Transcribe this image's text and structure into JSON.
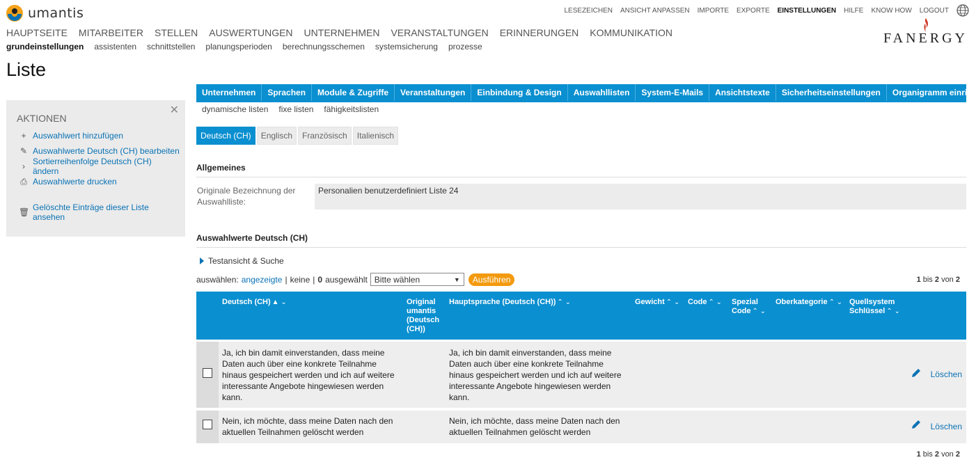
{
  "header": {
    "logo_text": "umantis",
    "brand": "FANERGY",
    "topnav": [
      "LESEZEICHEN",
      "ANSICHT ANPASSEN",
      "IMPORTE",
      "EXPORTE",
      "EINSTELLUNGEN",
      "HILFE",
      "KNOW HOW",
      "LOGOUT"
    ],
    "mainnav": [
      "HAUPTSEITE",
      "MITARBEITER",
      "STELLEN",
      "AUSWERTUNGEN",
      "UNTERNEHMEN",
      "VERANSTALTUNGEN",
      "ERINNERUNGEN",
      "KOMMUNIKATION"
    ],
    "subnav": [
      "grundeinstellungen",
      "assistenten",
      "schnittstellen",
      "planungsperioden",
      "berechnungsschemen",
      "systemsicherung",
      "prozesse"
    ]
  },
  "page_title": "Liste",
  "actions": {
    "title": "AKTIONEN",
    "close": "✕",
    "items": [
      {
        "icon": "+",
        "label": "Auswahlwert hinzufügen"
      },
      {
        "icon": "✎",
        "label": "Auswahlwerte Deutsch (CH) bearbeiten"
      },
      {
        "icon": "›",
        "label": "Sortierreihenfolge Deutsch (CH) ändern"
      },
      {
        "icon": "⎙",
        "label": "Auswahlwerte drucken"
      },
      {
        "icon": "🗑",
        "label": "Gelöschte Einträge dieser Liste ansehen"
      }
    ]
  },
  "tabs": [
    "Unternehmen",
    "Sprachen",
    "Module & Zugriffe",
    "Veranstaltungen",
    "Einbindung & Design",
    "Auswahllisten",
    "System-E-Mails",
    "Ansichtstexte",
    "Sicherheitseinstellungen",
    "Organigramm einrichten"
  ],
  "subtabs": [
    "dynamische listen",
    "fixe listen",
    "fähigkeitslisten"
  ],
  "languages": [
    "Deutsch (CH)",
    "Englisch",
    "Französisch",
    "Italienisch"
  ],
  "general": {
    "heading": "Allgemeines",
    "label_line1": "Originale Bezeichnung der",
    "label_line2": "Auswahlliste:",
    "value": "Personalien benutzerdefiniert Liste 24"
  },
  "values_section": {
    "heading": "Auswahlwerte Deutsch (CH)",
    "testansicht": "Testansicht & Suche",
    "select_prefix": "auswählen:",
    "select_shown": "angezeigte",
    "select_sep1": "|",
    "select_none": "keine",
    "select_sep2": "|",
    "selected_count": "0",
    "selected_suffix": "ausgewählt",
    "dropdown": "Bitte wählen",
    "dropdown_arrow": "▼",
    "run_button": "Ausführen",
    "pager": {
      "from": "1",
      "mid": "bis",
      "to": "2",
      "of_label": "von",
      "total": "2"
    }
  },
  "table": {
    "headers": {
      "deutsch": "Deutsch (CH)",
      "original_1": "Original",
      "original_2": "umantis",
      "original_3": "(Deutsch",
      "original_4": "(CH))",
      "hauptsprache": "Hauptsprache (Deutsch (CH))",
      "gewicht": "Gewicht",
      "code": "Code",
      "spezial_1": "Spezial",
      "spezial_2": "Code",
      "oberkategorie": "Oberkategorie",
      "quell_1": "Quellsystem",
      "quell_2": "Schlüssel"
    },
    "sort_active": "▲ ⌄",
    "sort_icons": "⌃ ⌄",
    "rows": [
      {
        "deutsch": [
          "Ja, ich bin damit einverstanden, dass meine",
          "Daten auch über eine konkrete Teilnahme",
          "hinaus gespeichert werden und ich auf weitere",
          "interessante Angebote hingewiesen werden",
          "kann."
        ],
        "hauptsprache": [
          "Ja, ich bin damit einverstanden, dass meine",
          "Daten auch über eine konkrete Teilnahme",
          "hinaus gespeichert werden und ich auf weitere",
          "interessante Angebote hingewiesen werden",
          "kann."
        ],
        "delete": "Löschen"
      },
      {
        "deutsch": [
          "Nein, ich möchte, dass meine Daten nach den",
          "aktuellen Teilnahmen gelöscht werden"
        ],
        "hauptsprache": [
          "Nein, ich möchte, dass meine Daten nach den",
          "aktuellen Teilnahmen gelöscht werden"
        ],
        "delete": "Löschen"
      }
    ]
  }
}
